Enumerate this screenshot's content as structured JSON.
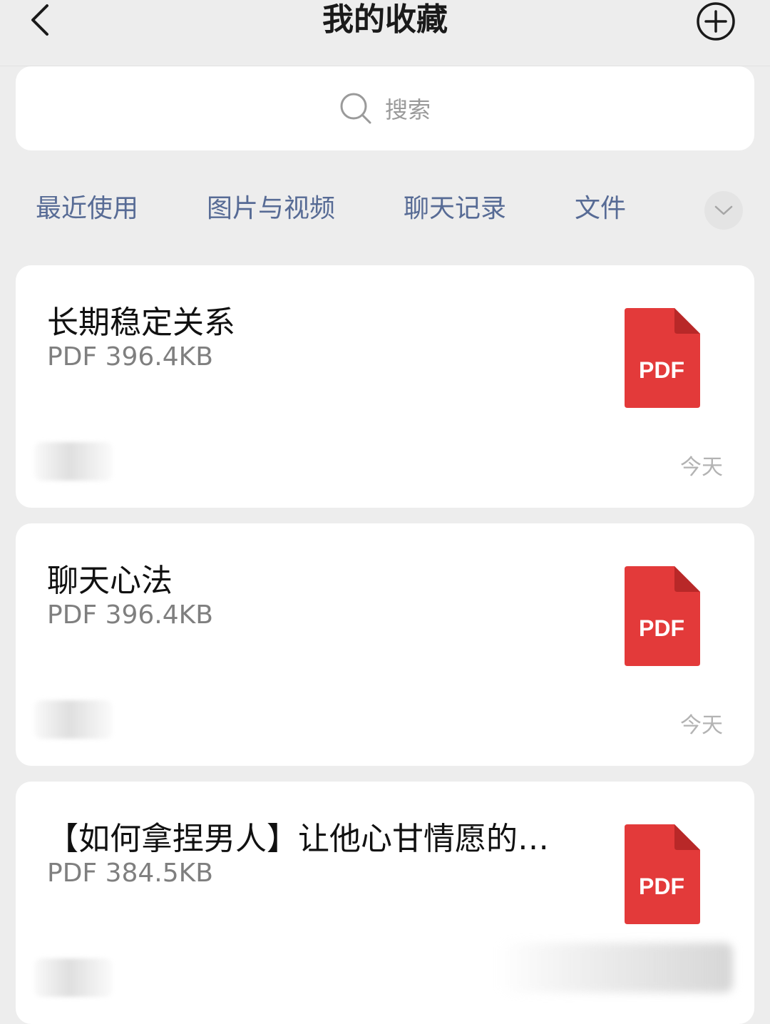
{
  "header": {
    "title": "我的收藏"
  },
  "search": {
    "placeholder": "搜索"
  },
  "tabs": [
    {
      "label": "最近使用"
    },
    {
      "label": "图片与视频"
    },
    {
      "label": "聊天记录"
    },
    {
      "label": "文件"
    }
  ],
  "items": [
    {
      "name": "长期稳定关系",
      "meta": "PDF 396.4KB",
      "date": "今天",
      "icon_label": "PDF"
    },
    {
      "name": "聊天心法",
      "meta": "PDF 396.4KB",
      "date": "今天",
      "icon_label": "PDF"
    },
    {
      "name": "【如何拿捏男人】让他心甘情愿的…",
      "meta": "PDF 384.5KB",
      "date": "",
      "icon_label": "PDF"
    }
  ],
  "colors": {
    "accent": "#576b95",
    "pdf_red": "#e33a3a",
    "pdf_fold": "#b82828",
    "background": "#ededed"
  }
}
